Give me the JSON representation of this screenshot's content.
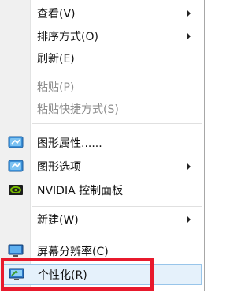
{
  "menu": {
    "items": [
      {
        "label": "查看(V)",
        "submenu": true
      },
      {
        "label": "排序方式(O)",
        "submenu": true
      },
      {
        "label": "刷新(E)"
      },
      {
        "label": "粘贴(P)",
        "disabled": true
      },
      {
        "label": "粘贴快捷方式(S)",
        "disabled": true
      },
      {
        "label": "图形属性......",
        "icon": "intel-graphics-icon"
      },
      {
        "label": "图形选项",
        "icon": "intel-graphics-icon",
        "submenu": true
      },
      {
        "label": "NVIDIA 控制面板",
        "icon": "nvidia-icon"
      },
      {
        "label": "新建(W)",
        "submenu": true
      },
      {
        "label": "屏幕分辨率(C)",
        "icon": "display-icon"
      },
      {
        "label": "个性化(R)",
        "icon": "personalize-icon"
      }
    ]
  },
  "highlight": {
    "color": "#e8192c"
  }
}
